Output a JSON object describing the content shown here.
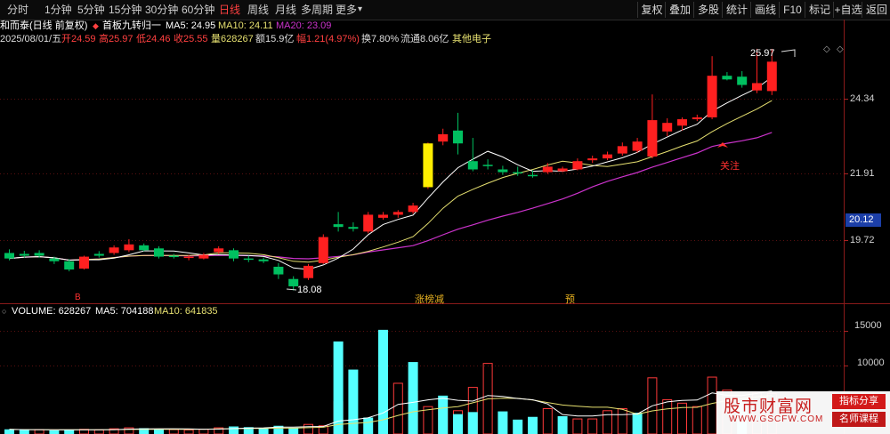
{
  "toolbar": {
    "timeframes": [
      {
        "label": "分时",
        "active": false
      },
      {
        "label": "1分钟",
        "active": false
      },
      {
        "label": "5分钟",
        "active": false
      },
      {
        "label": "15分钟",
        "active": false
      },
      {
        "label": "30分钟",
        "active": false
      },
      {
        "label": "60分钟",
        "active": false
      },
      {
        "label": "日线",
        "active": true
      },
      {
        "label": "周线",
        "active": false
      },
      {
        "label": "月线",
        "active": false
      },
      {
        "label": "多周期",
        "active": false
      },
      {
        "label": "更多",
        "active": false
      }
    ],
    "more_arrow": "▾",
    "right_buttons": [
      "复权",
      "叠加",
      "多股",
      "统计",
      "画线",
      "F10",
      "标记",
      "+自选",
      "返回"
    ]
  },
  "title": {
    "stock": "和而泰(日线 前复权)",
    "indicator": "首板九转归一",
    "ma5": "MA5: 24.95",
    "ma10": "MA10: 24.11",
    "ma20": "MA20: 23.09"
  },
  "info": {
    "date": "2025/08/01/五",
    "open": "开24.59",
    "high": "高25.97",
    "low": "低24.46",
    "close": "收25.55",
    "volume": "量628267",
    "amount": "额15.9亿",
    "change": "幅1.21(4.97%)",
    "turnover": "换7.80%",
    "float": "流通8.06亿",
    "sector": "其他电子"
  },
  "price_axis": {
    "ticks": [
      {
        "label": "24.34",
        "value": 24.34
      },
      {
        "label": "21.91",
        "value": 21.91
      },
      {
        "label": "19.72",
        "value": 19.72
      }
    ],
    "current": "20.12"
  },
  "annotations": {
    "high_label": "25.97",
    "low_label": "18.08",
    "follow_label": "关注",
    "marker_b": "B",
    "marker_zt": "涨榜减",
    "marker_yu": "预"
  },
  "volume_panel": {
    "title": "VOLUME: 628267",
    "ma5": "MA5: 704188",
    "ma10": "MA10: 641835",
    "ticks": [
      {
        "label": "15000",
        "value": 15000
      },
      {
        "label": "10000",
        "value": 10000
      }
    ]
  },
  "watermark": {
    "brand": "股市财富网",
    "url": "WWW.GSCFW.COM",
    "tag1": "指标分享",
    "tag2": "名师课程"
  },
  "colors": {
    "up": "#ff2020",
    "down": "#00c060",
    "highlight": "#ffee00",
    "ma5": "#ffffff",
    "ma10": "#e6e070",
    "ma20": "#cc33cc",
    "vol_up": "#ff3a3a",
    "vol_down": "#55ffff"
  },
  "chart_data": {
    "type": "candlestick",
    "price_range": [
      17.6,
      26.6
    ],
    "volume_range": [
      0,
      17000
    ],
    "candles": [
      {
        "o": 19.3,
        "h": 19.42,
        "l": 19.06,
        "c": 19.12
      },
      {
        "o": 19.27,
        "h": 19.37,
        "l": 19.15,
        "c": 19.21
      },
      {
        "o": 19.3,
        "h": 19.39,
        "l": 19.15,
        "c": 19.21
      },
      {
        "o": 19.12,
        "h": 19.18,
        "l": 18.94,
        "c": 19.03
      },
      {
        "o": 19.03,
        "h": 19.1,
        "l": 18.7,
        "c": 18.76
      },
      {
        "o": 18.79,
        "h": 19.21,
        "l": 18.76,
        "c": 19.18
      },
      {
        "o": 19.27,
        "h": 19.36,
        "l": 19.15,
        "c": 19.21
      },
      {
        "o": 19.3,
        "h": 19.55,
        "l": 19.24,
        "c": 19.48
      },
      {
        "o": 19.39,
        "h": 19.75,
        "l": 19.33,
        "c": 19.58
      },
      {
        "o": 19.55,
        "h": 19.61,
        "l": 19.36,
        "c": 19.39
      },
      {
        "o": 19.45,
        "h": 19.52,
        "l": 19.12,
        "c": 19.18
      },
      {
        "o": 19.21,
        "h": 19.27,
        "l": 19.12,
        "c": 19.18
      },
      {
        "o": 19.15,
        "h": 19.24,
        "l": 19.06,
        "c": 19.18
      },
      {
        "o": 19.12,
        "h": 19.3,
        "l": 19.09,
        "c": 19.24
      },
      {
        "o": 19.33,
        "h": 19.52,
        "l": 19.27,
        "c": 19.45
      },
      {
        "o": 19.39,
        "h": 19.45,
        "l": 19.03,
        "c": 19.12
      },
      {
        "o": 19.12,
        "h": 19.21,
        "l": 19.0,
        "c": 19.09
      },
      {
        "o": 19.09,
        "h": 19.15,
        "l": 18.97,
        "c": 19.03
      },
      {
        "o": 18.85,
        "h": 18.97,
        "l": 18.45,
        "c": 18.6
      },
      {
        "o": 18.45,
        "h": 18.54,
        "l": 18.08,
        "c": 18.21
      },
      {
        "o": 18.48,
        "h": 18.94,
        "l": 18.42,
        "c": 18.88
      },
      {
        "o": 18.97,
        "h": 19.91,
        "l": 18.94,
        "c": 19.82
      },
      {
        "o": 20.24,
        "h": 20.64,
        "l": 20.0,
        "c": 20.15
      },
      {
        "o": 20.15,
        "h": 20.3,
        "l": 20.0,
        "c": 20.09
      },
      {
        "o": 20.0,
        "h": 20.64,
        "l": 19.94,
        "c": 20.55
      },
      {
        "o": 20.45,
        "h": 20.64,
        "l": 20.39,
        "c": 20.55
      },
      {
        "o": 20.55,
        "h": 20.7,
        "l": 20.45,
        "c": 20.64
      },
      {
        "o": 20.64,
        "h": 20.94,
        "l": 20.58,
        "c": 20.85
      },
      {
        "o": 21.45,
        "h": 22.91,
        "l": 21.39,
        "c": 22.88
      },
      {
        "o": 22.94,
        "h": 23.36,
        "l": 22.82,
        "c": 23.18
      },
      {
        "o": 23.3,
        "h": 23.88,
        "l": 22.52,
        "c": 22.88
      },
      {
        "o": 22.3,
        "h": 23.06,
        "l": 21.97,
        "c": 22.03
      },
      {
        "o": 22.18,
        "h": 22.36,
        "l": 22.03,
        "c": 22.15
      }
    ],
    "volumes": [
      {
        "v": 680,
        "up": false
      },
      {
        "v": 600,
        "up": false
      },
      {
        "v": 620,
        "up": true
      },
      {
        "v": 520,
        "up": false
      },
      {
        "v": 600,
        "up": false
      },
      {
        "v": 680,
        "up": true
      },
      {
        "v": 600,
        "up": true
      },
      {
        "v": 760,
        "up": true
      },
      {
        "v": 900,
        "up": true
      },
      {
        "v": 850,
        "up": false
      },
      {
        "v": 700,
        "up": false
      },
      {
        "v": 650,
        "up": true
      },
      {
        "v": 600,
        "up": true
      },
      {
        "v": 700,
        "up": true
      },
      {
        "v": 900,
        "up": true
      },
      {
        "v": 1100,
        "up": false
      },
      {
        "v": 1000,
        "up": false
      },
      {
        "v": 800,
        "up": false
      },
      {
        "v": 1200,
        "up": false
      },
      {
        "v": 900,
        "up": false
      },
      {
        "v": 1400,
        "up": true
      },
      {
        "v": 1200,
        "up": true
      },
      {
        "v": 4700,
        "up": true
      },
      {
        "v": 2200,
        "up": false
      },
      {
        "v": 2400,
        "up": false
      },
      {
        "v": 4900,
        "up": true
      },
      {
        "v": 7400,
        "up": true
      },
      {
        "v": 6200,
        "up": true
      },
      {
        "v": 4000,
        "up": true
      },
      {
        "v": 3600,
        "up": true
      },
      {
        "v": 3400,
        "up": true
      },
      {
        "v": 6800,
        "up": true
      },
      {
        "v": 10300,
        "up": true
      }
    ]
  }
}
